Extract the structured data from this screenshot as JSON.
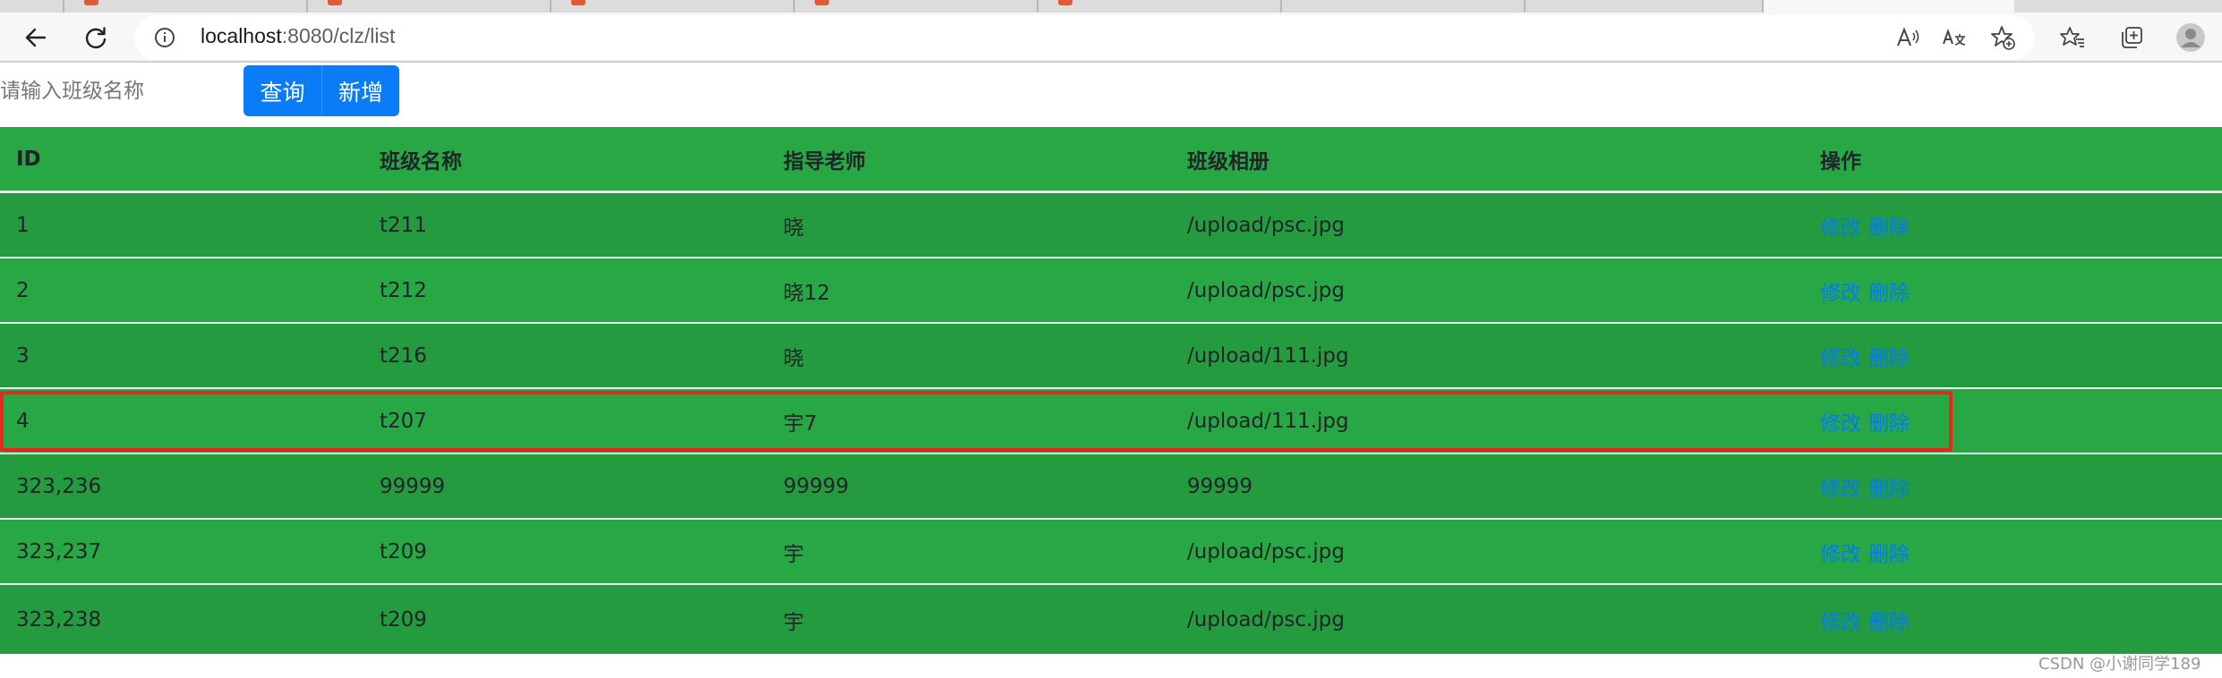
{
  "browser": {
    "address_url_host": "localhost",
    "address_url_rest": ":8080/clz/list",
    "icons": [
      "back-icon",
      "refresh-icon",
      "info-icon",
      "read-aloud-icon",
      "translate-icon",
      "add-favorite-icon",
      "favorites-icon",
      "collections-icon",
      "profile-icon"
    ]
  },
  "search": {
    "placeholder": "请输入班级名称",
    "query_label": "查询",
    "add_label": "新增"
  },
  "table": {
    "headers": [
      "ID",
      "班级名称",
      "指导老师",
      "班级相册",
      "操作"
    ],
    "rows": [
      {
        "id": "1",
        "name": "t211",
        "teacher": "晓",
        "album": "/upload/psc.jpg",
        "edit": "修改",
        "delete": "删除"
      },
      {
        "id": "2",
        "name": "t212",
        "teacher": "晓12",
        "album": "/upload/psc.jpg",
        "edit": "修改",
        "delete": "删除"
      },
      {
        "id": "3",
        "name": "t216",
        "teacher": "晓",
        "album": "/upload/111.jpg",
        "edit": "修改",
        "delete": "删除"
      },
      {
        "id": "4",
        "name": "t207",
        "teacher": "宇7",
        "album": "/upload/111.jpg",
        "edit": "修改",
        "delete": "删除"
      },
      {
        "id": "323,236",
        "name": "99999",
        "teacher": "99999",
        "album": "99999",
        "edit": "修改",
        "delete": "删除"
      },
      {
        "id": "323,237",
        "name": "t209",
        "teacher": "宇",
        "album": "/upload/psc.jpg",
        "edit": "修改",
        "delete": "删除"
      },
      {
        "id": "323,238",
        "name": "t209",
        "teacher": "宇",
        "album": "/upload/psc.jpg",
        "edit": "修改",
        "delete": "删除"
      }
    ]
  },
  "colors": {
    "table_bg": "#28a745",
    "table_bg_alt": "#259b40",
    "button": "#0a7cf7",
    "link": "#007bff",
    "highlight": "#e8261c"
  },
  "watermark": "CSDN @小谢同学189"
}
